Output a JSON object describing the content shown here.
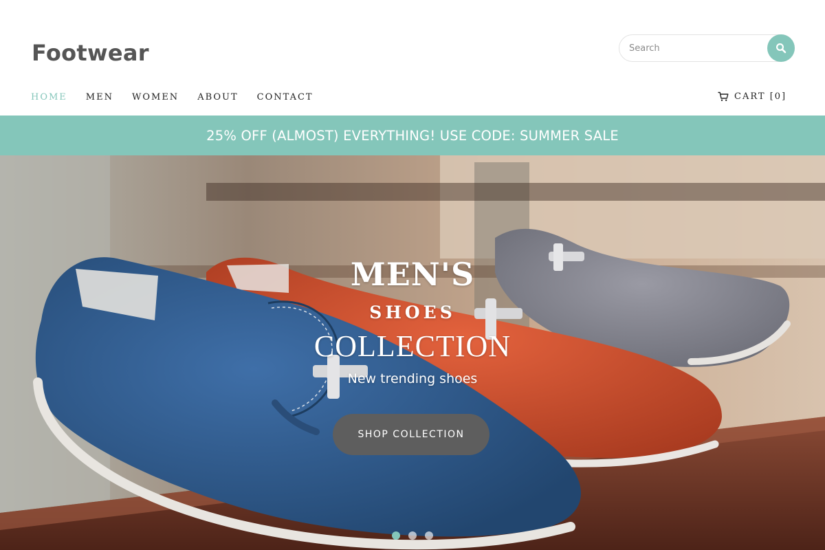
{
  "brand": {
    "name": "Footwear"
  },
  "search": {
    "placeholder": "Search",
    "icon": "search-icon"
  },
  "nav": {
    "items": [
      {
        "label": "HOME",
        "active": true
      },
      {
        "label": "MEN",
        "active": false
      },
      {
        "label": "WOMEN",
        "active": false
      },
      {
        "label": "ABOUT",
        "active": false
      },
      {
        "label": "CONTACT",
        "active": false
      }
    ]
  },
  "cart": {
    "label": "CART [0]",
    "icon": "cart-icon"
  },
  "promo": {
    "text": "25% OFF (ALMOST) EVERYTHING! USE CODE: SUMMER SALE"
  },
  "hero": {
    "title": "MEN'S",
    "subtitle": "SHOES",
    "subtitle2": "COLLECTION",
    "description": "New trending shoes",
    "cta": "SHOP COLLECTION",
    "slides": {
      "count": 3,
      "active": 1
    }
  },
  "colors": {
    "accent": "#84c6ba",
    "button": "#5e5e5e",
    "logo": "#555555",
    "nav_text": "#222222"
  }
}
